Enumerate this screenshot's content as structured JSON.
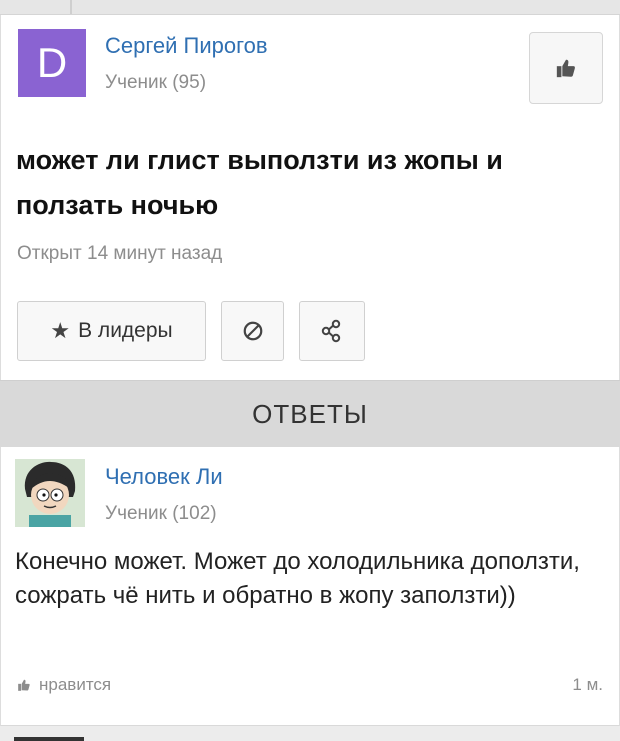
{
  "question": {
    "author": {
      "initial": "D",
      "name": "Сергей Пирогов",
      "rank": "Ученик (95)",
      "avatar_color": "#8a63d2"
    },
    "title": "может ли глист выползти из жопы и ползать ночью",
    "opened": "Открыт 14 минут назад",
    "actions": {
      "leaders_label": "В лидеры",
      "leaders_icon": "star-icon",
      "block_icon": "block-icon",
      "share_icon": "share-icon"
    },
    "like_icon": "thumbs-up-icon"
  },
  "answers_header": "ОТВЕТЫ",
  "answer": {
    "author": {
      "name": "Человек Ли",
      "rank": "Ученик (102)"
    },
    "text": "Конечно может. Может до холодильника доползти, сожрать чё нить и обратно в жопу заползти))",
    "like_label": "нравится",
    "time": "1 м."
  },
  "colors": {
    "link": "#2f6fb2",
    "muted": "#8d8d8d",
    "header_bg": "#d9d9d9"
  }
}
